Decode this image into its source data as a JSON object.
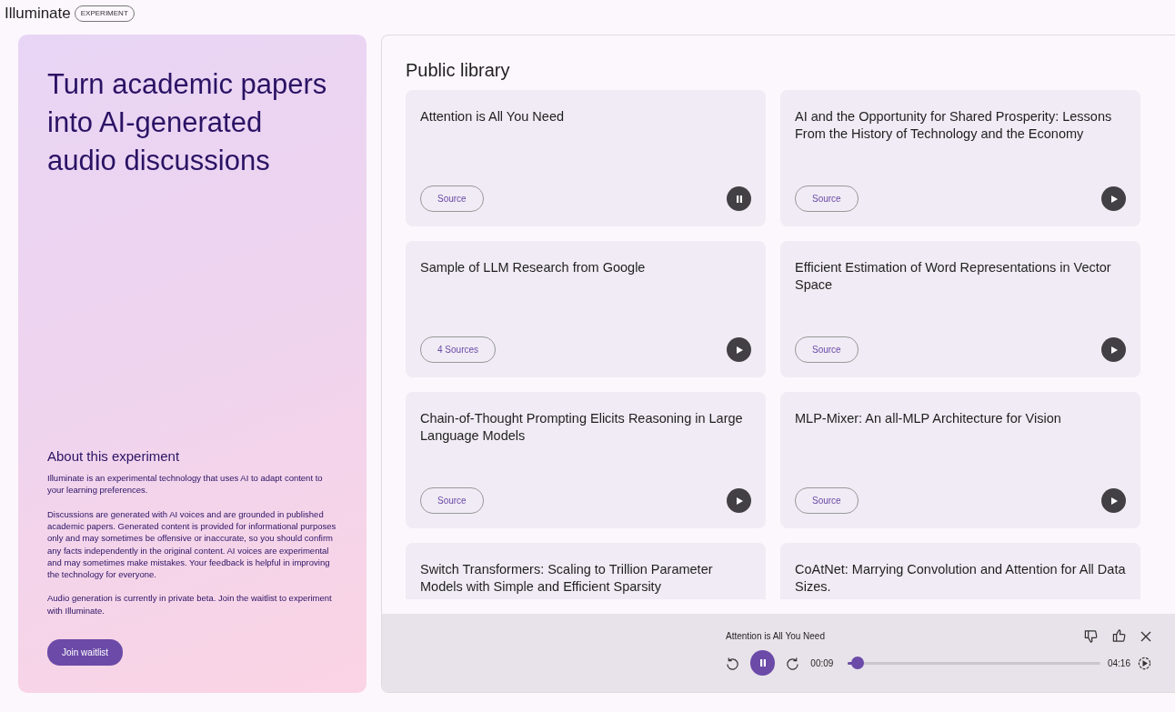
{
  "header": {
    "logo": "Illuminate",
    "badge": "EXPERIMENT"
  },
  "hero": {
    "headline": "Turn academic papers into AI-generated audio discussions",
    "about_title": "About this experiment",
    "paragraphs": [
      "Illuminate is an experimental technology that uses AI to adapt content to your learning preferences.",
      "Discussions are generated with AI voices and are grounded in published academic papers. Generated content is provided for informational purposes only and may sometimes be offensive or inaccurate, so you should confirm any facts independently in the original content. AI voices are experimental and may sometimes make mistakes. Your feedback is helpful in improving the technology for everyone.",
      "Audio generation is currently in private beta. Join the waitlist to experiment with Illuminate."
    ],
    "button": "Join waitlist"
  },
  "library": {
    "title": "Public library",
    "cards": [
      {
        "title": "Attention is All You Need",
        "source": "Source",
        "playing": true
      },
      {
        "title": "AI and the Opportunity for Shared Prosperity: Lessons From the History of Technology and the Economy",
        "source": "Source",
        "playing": false
      },
      {
        "title": "Sample of LLM Research from Google",
        "source": "4 Sources",
        "playing": false
      },
      {
        "title": "Efficient Estimation of Word Representations in Vector Space",
        "source": "Source",
        "playing": false
      },
      {
        "title": "Chain-of-Thought Prompting Elicits Reasoning in Large Language Models",
        "source": "Source",
        "playing": false
      },
      {
        "title": "MLP-Mixer: An all-MLP Architecture for Vision",
        "source": "Source",
        "playing": false
      },
      {
        "title": "Switch Transformers: Scaling to Trillion Parameter Models with Simple and Efficient Sparsity"
      },
      {
        "title": "CoAtNet: Marrying Convolution and Attention for All Data Sizes."
      }
    ]
  },
  "player": {
    "title": "Attention is All You Need",
    "playing": true,
    "elapsed": "00:09",
    "duration": "04:16",
    "level": 0.04
  }
}
